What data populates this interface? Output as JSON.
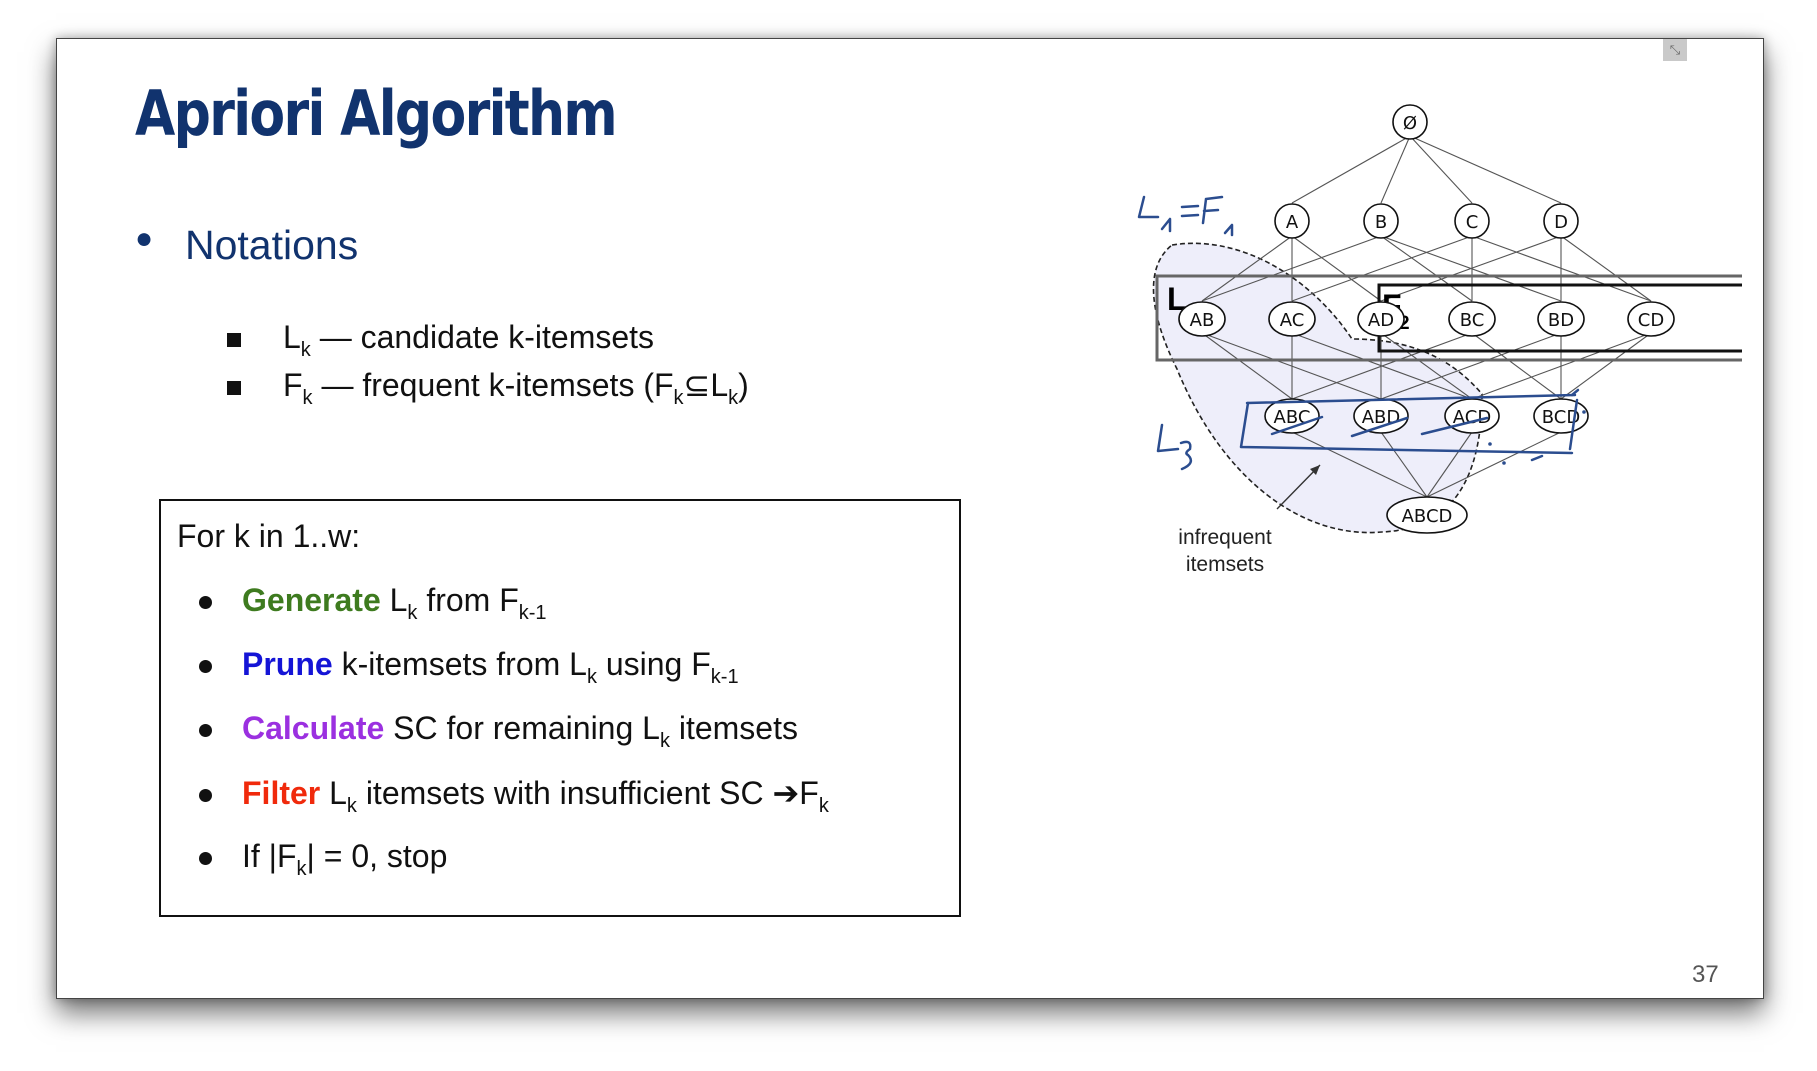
{
  "slide": {
    "title": "Apriori Algorithm",
    "page_number": "37",
    "corner_button_icon": "collapse-icon"
  },
  "notations": {
    "label": "Notations",
    "items": [
      {
        "symbol": "L",
        "sub": "k",
        "text": " — candidate k-itemsets"
      },
      {
        "symbol": "F",
        "sub": "k",
        "text": " — frequent k-itemsets (F",
        "sub2": "k",
        "text2": "⊆L",
        "sub3": "k",
        "text3": ")"
      }
    ]
  },
  "algorithm": {
    "heading": "For k in 1..w:",
    "steps": [
      {
        "keyword": "Generate",
        "color": "#3e7b1f",
        "parts": [
          " L",
          "k",
          " from F",
          "k-1"
        ]
      },
      {
        "keyword": "Prune",
        "color": "#1414d6",
        "parts": [
          " k-itemsets from L",
          "k",
          " using F",
          "k-1"
        ]
      },
      {
        "keyword": "Calculate",
        "color": "#9b30e0",
        "parts": [
          " SC for remaining L",
          "k",
          " itemsets"
        ]
      },
      {
        "keyword": "Filter",
        "color": "#f02a0c",
        "parts": [
          " L",
          "k",
          " itemsets with insufficient SC ",
          "➔",
          "F",
          "k"
        ]
      },
      {
        "keyword": "",
        "color": "#111111",
        "parts": [
          "If |F",
          "k",
          "| = 0, stop"
        ]
      }
    ]
  },
  "lattice": {
    "root": "Ø",
    "level1": [
      "A",
      "B",
      "C",
      "D"
    ],
    "level2": [
      "AB",
      "AC",
      "AD",
      "BC",
      "BD",
      "CD"
    ],
    "level3": [
      "ABC",
      "ABD",
      "ACD",
      "BCD"
    ],
    "level4": [
      "ABCD"
    ],
    "box_label_L2": "L",
    "box_label_L2_sub": "2",
    "box_label_F2": "F",
    "box_label_F2_sub": "2",
    "infrequent_label_line1": "infrequent",
    "infrequent_label_line2": "itemsets",
    "hand_note_1": "L1 = F1",
    "hand_note_2": "L3",
    "ink_color": "#2b4d8f"
  }
}
